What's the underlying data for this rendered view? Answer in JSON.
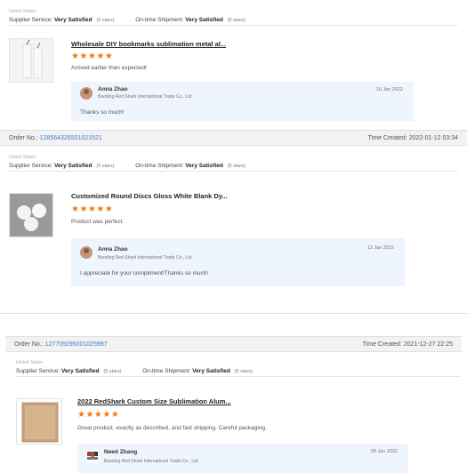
{
  "reviews": [
    {
      "order_label": "",
      "order_no": "",
      "time_label": "",
      "time": "",
      "country": "United States",
      "supplier_service_label": "Supplier Service:",
      "supplier_service_value": "Very Satisfied",
      "supplier_stars": "(5 stars)",
      "shipment_label": "On-time Shipment:",
      "shipment_value": "Very Satisfied",
      "shipment_stars": "(5 stars)",
      "product_title": "Wholesale DIY bookmarks sublimation metal al...",
      "stars": "★★★★★",
      "comment": "Arrived earlier than expected!",
      "reply_name": "Anna Zhao",
      "reply_company": "Baoding Red Shark International Trade Co., Ltd.",
      "reply_date": "16 Jan 2022",
      "reply_text": "Thanks so much!"
    },
    {
      "order_label": "Order No.:",
      "order_no": "128564326501021521",
      "time_label": "Time Created:",
      "time": "2022-01-12 03:34",
      "country": "United States",
      "supplier_service_label": "Supplier Service:",
      "supplier_service_value": "Very Satisfied",
      "supplier_stars": "(5 stars)",
      "shipment_label": "On-time Shipment:",
      "shipment_value": "Very Satisfied",
      "shipment_stars": "(5 stars)",
      "product_title": "Customized Round Discs Gloss White Blank Dy...",
      "stars": "★★★★★",
      "comment": "Product was perfect.",
      "reply_name": "Anna Zhao",
      "reply_company": "Baoding Red Shark International Trade Co., Ltd.",
      "reply_date": "13 Jan 2022",
      "reply_text": "I appreciate for your compliment!Thanks so much!"
    },
    {
      "order_label": "Order No.:",
      "order_no": "127709295001025987",
      "time_label": "Time Created:",
      "time": "2021-12-27 22:25",
      "country": "United States",
      "supplier_service_label": "Supplier Service:",
      "supplier_service_value": "Very Satisfied",
      "supplier_stars": "(5 stars)",
      "shipment_label": "On-time Shipment:",
      "shipment_value": "Very Satisfied",
      "shipment_stars": "(5 stars)",
      "product_title": "2022 RedShark Custom Size Sublimation Alum...",
      "stars": "★★★★★",
      "comment": "Great product, exactly as described, and fast shipping. Careful packaging.",
      "reply_name": "Need Zhang",
      "reply_company": "Baoding Red Shark International Trade Co., Ltd.",
      "reply_date": "09 Jan 2022",
      "reply_text": ""
    }
  ]
}
